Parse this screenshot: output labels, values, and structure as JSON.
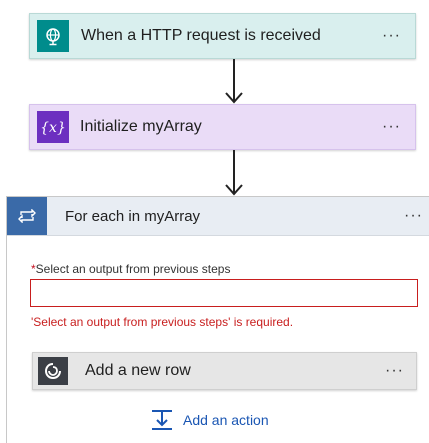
{
  "http_trigger": {
    "title": "When a HTTP request is received",
    "icon": "globe-icon",
    "menu": "···",
    "color": "#008c8c"
  },
  "init_variable": {
    "title": "Initialize myArray",
    "icon": "variable-icon",
    "menu": "···",
    "color": "#6c2fc0"
  },
  "foreach": {
    "title": "For each in myArray",
    "icon": "loop-icon",
    "menu": "···",
    "field": {
      "required_mark": "*",
      "label": "Select an output from previous steps",
      "value": "",
      "placeholder": "",
      "error": "'Select an output from previous steps' is required."
    },
    "inner_action": {
      "title": "Add a new row",
      "icon": "dataverse-icon",
      "menu": "···"
    },
    "add_action": {
      "label": "Add an action",
      "icon": "add-action-icon"
    }
  },
  "colors": {
    "error": "#c81e1e",
    "link": "#1a56b3",
    "loop": "#3a6aa8"
  }
}
